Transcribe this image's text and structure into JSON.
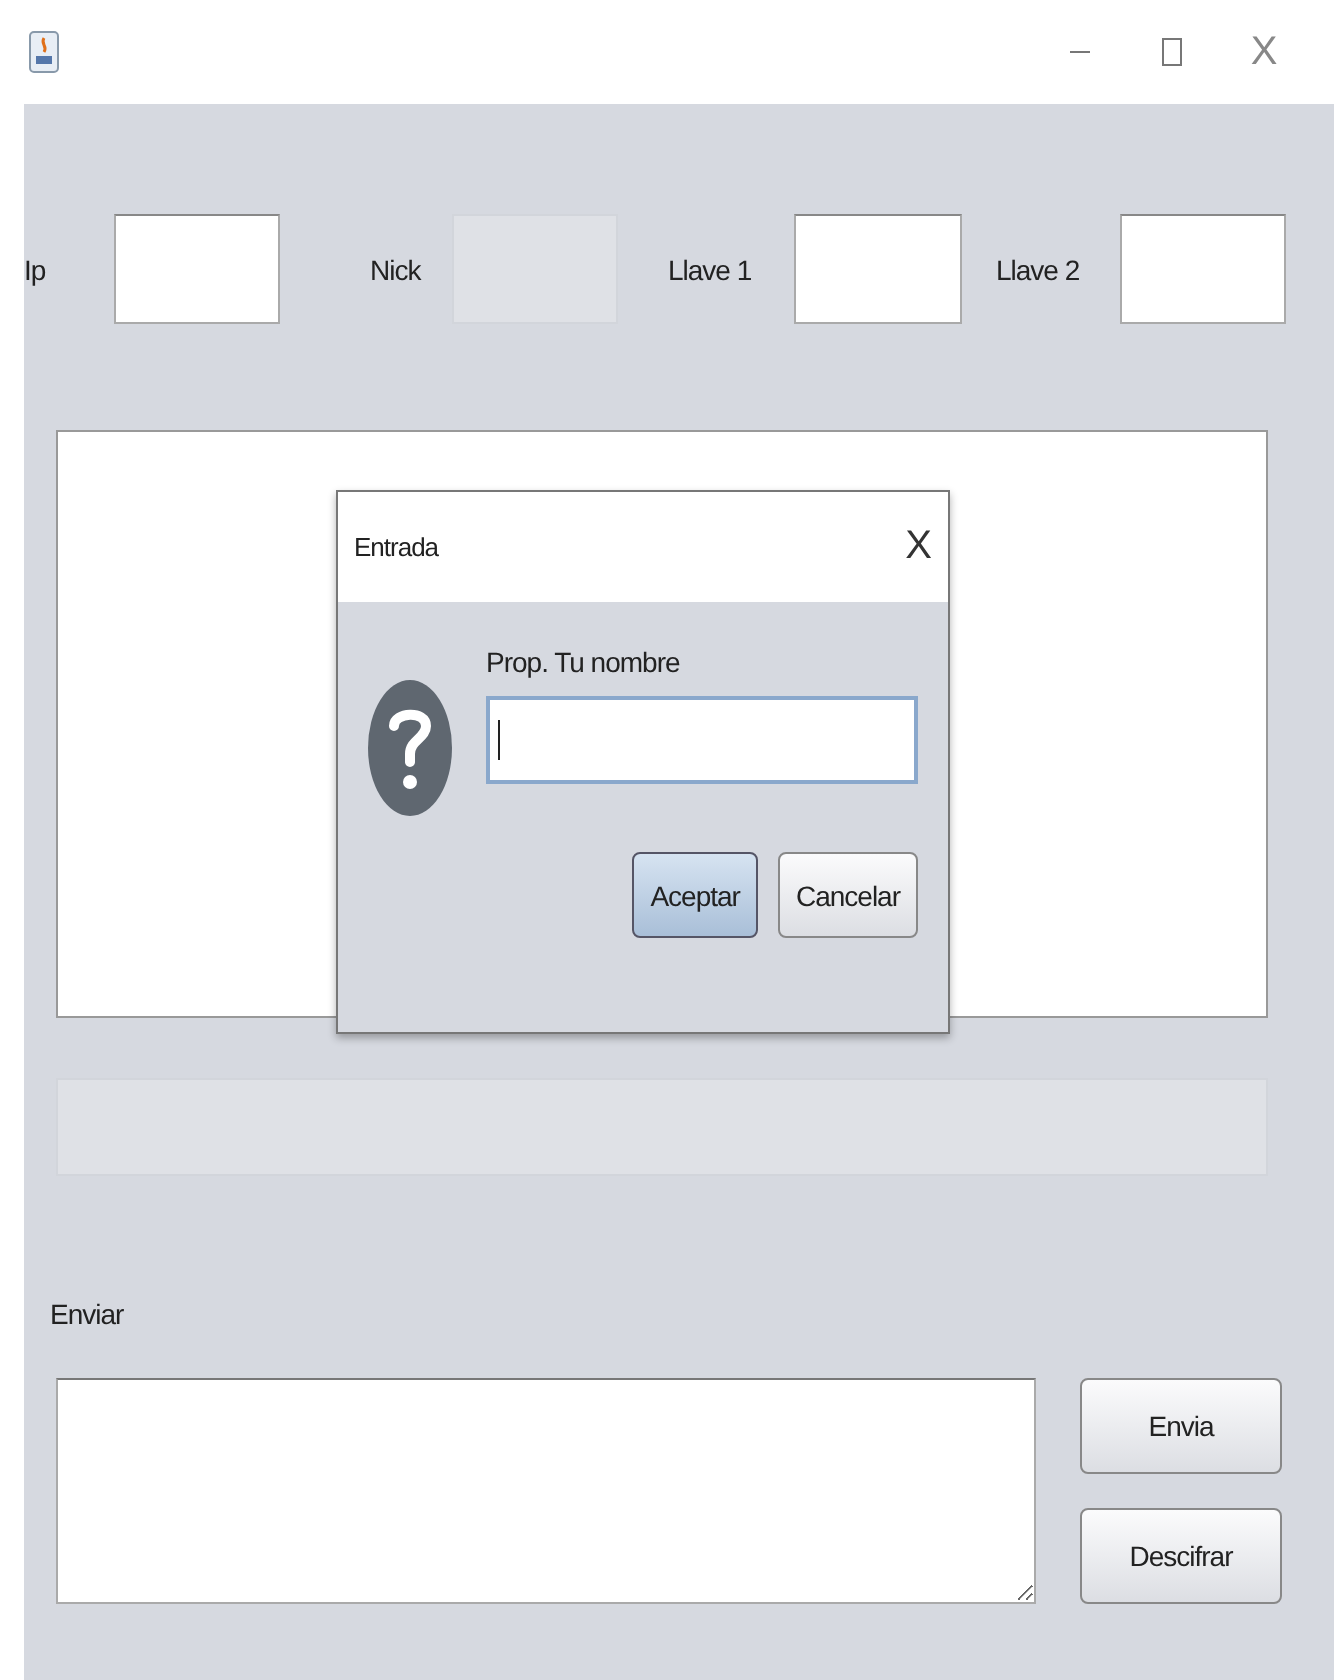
{
  "window": {
    "close": "X"
  },
  "fields": [
    {
      "label": "Ip",
      "disabled": false
    },
    {
      "label": "Nick",
      "disabled": true
    },
    {
      "label": "Llave 1",
      "disabled": false
    },
    {
      "label": "Llave 2",
      "disabled": false
    }
  ],
  "status_field": {
    "disabled": true
  },
  "send_label": "Enviar",
  "buttons": [
    "Envia",
    "Descifrar"
  ],
  "dialog": {
    "title": "Entrada",
    "close": "X",
    "prompt": "Prop. Tu nombre",
    "input_focused": true,
    "buttons": [
      {
        "label": "Aceptar",
        "default": true
      },
      {
        "label": "Cancelar",
        "default": false
      }
    ]
  }
}
